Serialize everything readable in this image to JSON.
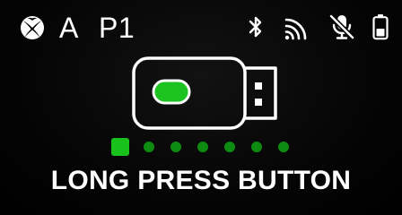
{
  "status_bar": {
    "profile_letter": "A",
    "player_slot": "P1",
    "icons": [
      "xbox-icon",
      "bluetooth-icon",
      "cast-icon",
      "mic-muted-icon",
      "battery-icon"
    ]
  },
  "pairing": {
    "device_icon": "usb-dongle-icon",
    "progress": {
      "total_steps": 7,
      "current_step": 1
    },
    "instruction": "LONG PRESS BUTTON"
  },
  "colors": {
    "background": "#000000",
    "text": "#ffffff",
    "accent_green": "#19c11d",
    "dim_green": "#0c8a12"
  }
}
